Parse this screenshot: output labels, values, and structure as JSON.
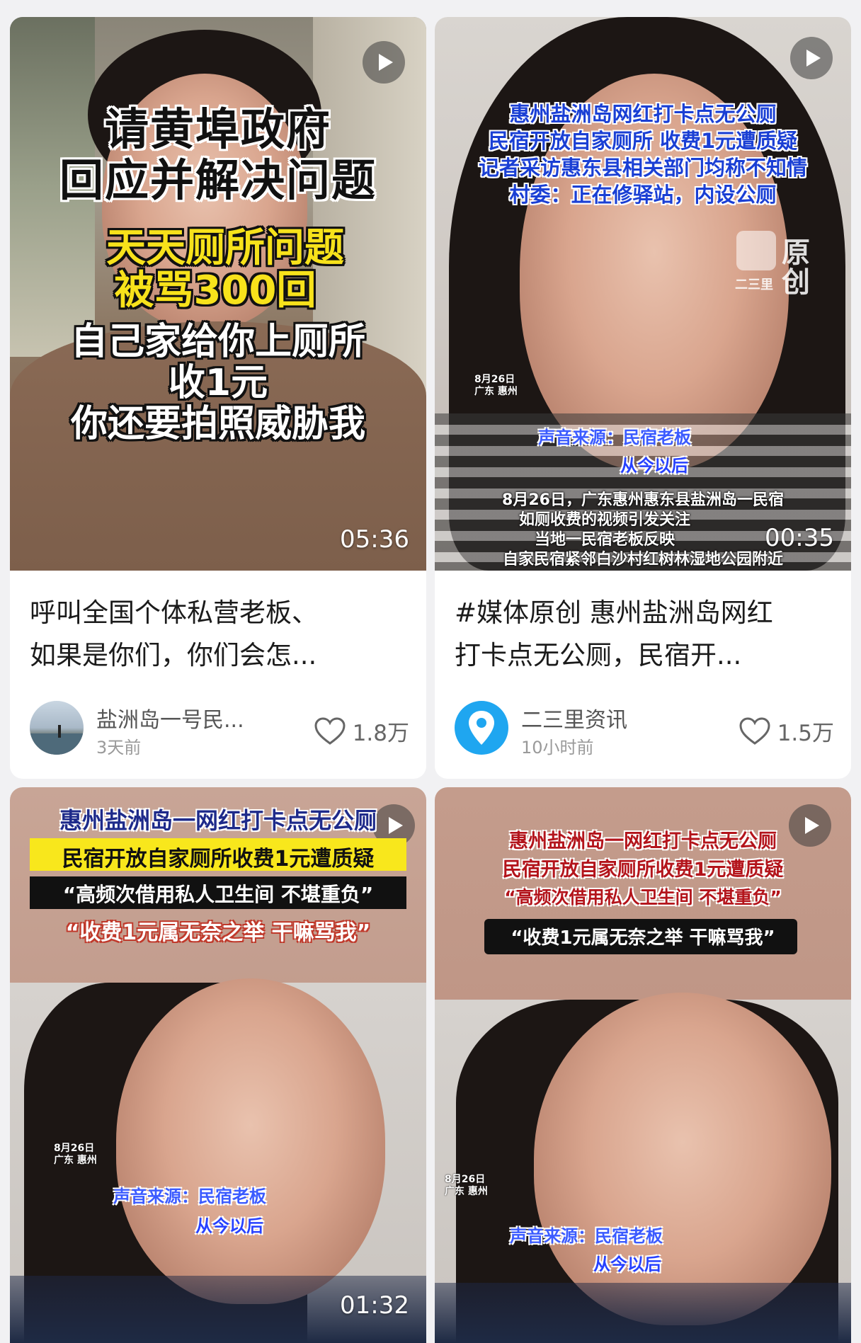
{
  "cards": [
    {
      "overlay": {
        "headline": [
          "请黄埠政府",
          "回应并解决问题"
        ],
        "yellow": [
          "天天厕所问题",
          "被骂300回"
        ],
        "white": [
          "自己家给你上厕所",
          "收1元",
          "你还要拍照威胁我"
        ]
      },
      "duration": "05:36",
      "title_line1": "呼叫全国个体私营老板、",
      "title_line2": "如果是你们，你们会怎...",
      "author": "盐洲岛一号民...",
      "time": "3天前",
      "likes": "1.8万"
    },
    {
      "overlay": {
        "blue": [
          "惠州盐洲岛网红打卡点无公厕",
          "民宿开放自家厕所 收费1元遭质疑",
          "记者采访惠东县相关部门均称不知情",
          "村委：正在修驿站，内设公厕"
        ],
        "watermark": [
          "原",
          "创",
          "二三里"
        ],
        "date": [
          "8月26日",
          "广东 惠州"
        ],
        "voice_source": "声音来源：民宿老板",
        "subtitle": "从今以后",
        "white": [
          "8月26日，广东惠州惠东县盐洲岛一民宿",
          "如厕收费的视频引发关注",
          "当地一民宿老板反映",
          "自家民宿紧邻白沙村红树林湿地公园附近"
        ]
      },
      "duration": "00:35",
      "title_line1": "#媒体原创 惠州盐洲岛网红",
      "title_line2": "打卡点无公厕，民宿开...",
      "author": "二三里资讯",
      "time": "10小时前",
      "likes": "1.5万"
    },
    {
      "overlay": {
        "banners": [
          "惠州盐洲岛一网红打卡点无公厕",
          "民宿开放自家厕所收费1元遭质疑",
          "“高频次借用私人卫生间  不堪重负”",
          "“收费1元属无奈之举 干嘛骂我”"
        ],
        "date": [
          "8月26日",
          "广东 惠州"
        ],
        "voice_source": "声音来源：民宿老板",
        "subtitle": "从今以后"
      },
      "duration": "01:32"
    },
    {
      "overlay": {
        "banners": [
          "惠州盐洲岛一网红打卡点无公厕",
          "民宿开放自家厕所收费1元遭质疑",
          "“高频次借用私人卫生间 不堪重负”",
          "“收费1元属无奈之举 干嘛骂我”"
        ],
        "date": [
          "8月26日",
          "广东 惠州"
        ],
        "voice_source": "声音来源：民宿老板",
        "subtitle": "从今以后"
      }
    }
  ],
  "colors": {
    "background": "#f1f1f3",
    "heart": "#666666",
    "location_pin": "#1fa6f0"
  },
  "icons": [
    "play-icon",
    "heart-icon",
    "location-pin-icon"
  ]
}
